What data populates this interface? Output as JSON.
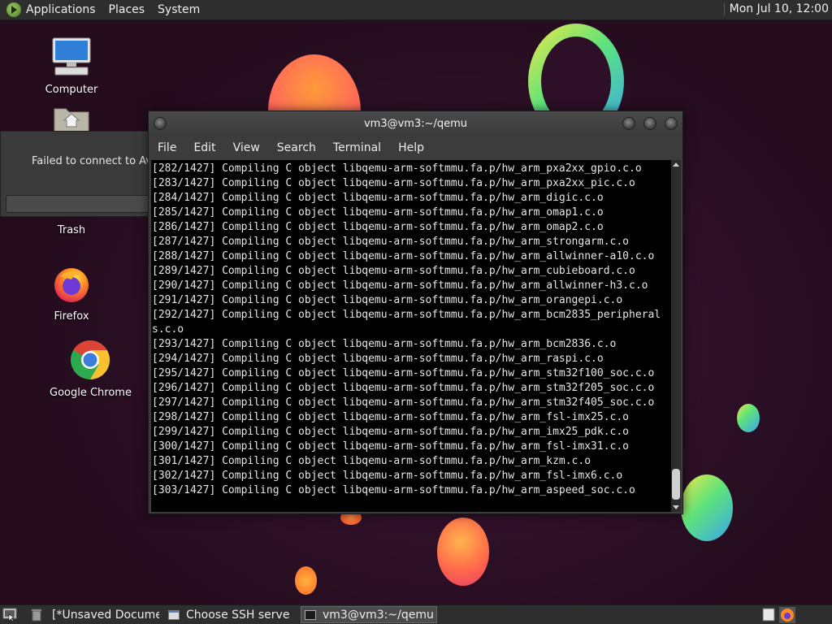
{
  "top_panel": {
    "menus": [
      "Applications",
      "Places",
      "System"
    ],
    "clock": "Mon Jul 10, 12:00"
  },
  "desktop": {
    "icons": [
      {
        "label": "Computer",
        "icon": "computer-icon"
      },
      {
        "label": "",
        "icon": "home-folder-icon"
      },
      {
        "label": "Trash",
        "icon": "trash-icon"
      },
      {
        "label": "Firefox",
        "icon": "firefox-icon"
      },
      {
        "label": "Google Chrome",
        "icon": "chrome-icon"
      }
    ]
  },
  "failed_dialog": {
    "message": "Failed to connect to Ava"
  },
  "terminal": {
    "title": "vm3@vm3:~/qemu",
    "menus": [
      "File",
      "Edit",
      "View",
      "Search",
      "Terminal",
      "Help"
    ],
    "lines": [
      "[282/1427] Compiling C object libqemu-arm-softmmu.fa.p/hw_arm_pxa2xx_gpio.c.o",
      "[283/1427] Compiling C object libqemu-arm-softmmu.fa.p/hw_arm_pxa2xx_pic.c.o",
      "[284/1427] Compiling C object libqemu-arm-softmmu.fa.p/hw_arm_digic.c.o",
      "[285/1427] Compiling C object libqemu-arm-softmmu.fa.p/hw_arm_omap1.c.o",
      "[286/1427] Compiling C object libqemu-arm-softmmu.fa.p/hw_arm_omap2.c.o",
      "[287/1427] Compiling C object libqemu-arm-softmmu.fa.p/hw_arm_strongarm.c.o",
      "[288/1427] Compiling C object libqemu-arm-softmmu.fa.p/hw_arm_allwinner-a10.c.o",
      "[289/1427] Compiling C object libqemu-arm-softmmu.fa.p/hw_arm_cubieboard.c.o",
      "[290/1427] Compiling C object libqemu-arm-softmmu.fa.p/hw_arm_allwinner-h3.c.o",
      "[291/1427] Compiling C object libqemu-arm-softmmu.fa.p/hw_arm_orangepi.c.o",
      "[292/1427] Compiling C object libqemu-arm-softmmu.fa.p/hw_arm_bcm2835_peripheral",
      "s.c.o",
      "[293/1427] Compiling C object libqemu-arm-softmmu.fa.p/hw_arm_bcm2836.c.o",
      "[294/1427] Compiling C object libqemu-arm-softmmu.fa.p/hw_arm_raspi.c.o",
      "[295/1427] Compiling C object libqemu-arm-softmmu.fa.p/hw_arm_stm32f100_soc.c.o",
      "[296/1427] Compiling C object libqemu-arm-softmmu.fa.p/hw_arm_stm32f205_soc.c.o",
      "[297/1427] Compiling C object libqemu-arm-softmmu.fa.p/hw_arm_stm32f405_soc.c.o",
      "[298/1427] Compiling C object libqemu-arm-softmmu.fa.p/hw_arm_fsl-imx25.c.o",
      "[299/1427] Compiling C object libqemu-arm-softmmu.fa.p/hw_arm_imx25_pdk.c.o",
      "[300/1427] Compiling C object libqemu-arm-softmmu.fa.p/hw_arm_fsl-imx31.c.o",
      "[301/1427] Compiling C object libqemu-arm-softmmu.fa.p/hw_arm_kzm.c.o",
      "[302/1427] Compiling C object libqemu-arm-softmmu.fa.p/hw_arm_fsl-imx6.c.o",
      "[303/1427] Compiling C object libqemu-arm-softmmu.fa.p/hw_arm_aspeed_soc.c.o"
    ]
  },
  "taskbar": {
    "tasks": [
      {
        "label": "[*Unsaved Docume...",
        "icon": "text-editor-icon",
        "active": false
      },
      {
        "label": "Choose SSH server",
        "icon": "window-icon",
        "active": false
      },
      {
        "label": "vm3@vm3:~/qemu",
        "icon": "terminal-icon",
        "active": true
      }
    ]
  }
}
